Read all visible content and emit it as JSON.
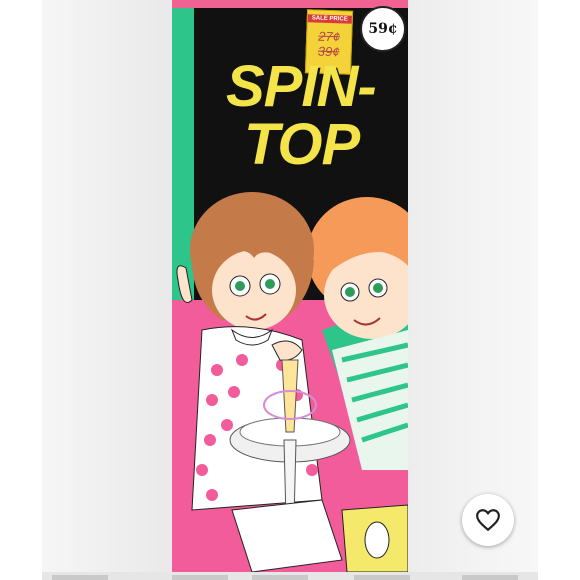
{
  "product": {
    "title_line1": "SPIN-",
    "title_line2": "TOP",
    "price_badge": "59¢",
    "sticker_label": "SALE PRICE",
    "sticker_price_1": "27¢",
    "sticker_price_2": "39¢"
  },
  "actions": {
    "like_icon": "heart-outline-icon"
  },
  "colors": {
    "package_black": "#111111",
    "title_yellow": "#f4e44a",
    "stripe_green": "#2ec58b",
    "panel_pink": "#f25c9a"
  }
}
